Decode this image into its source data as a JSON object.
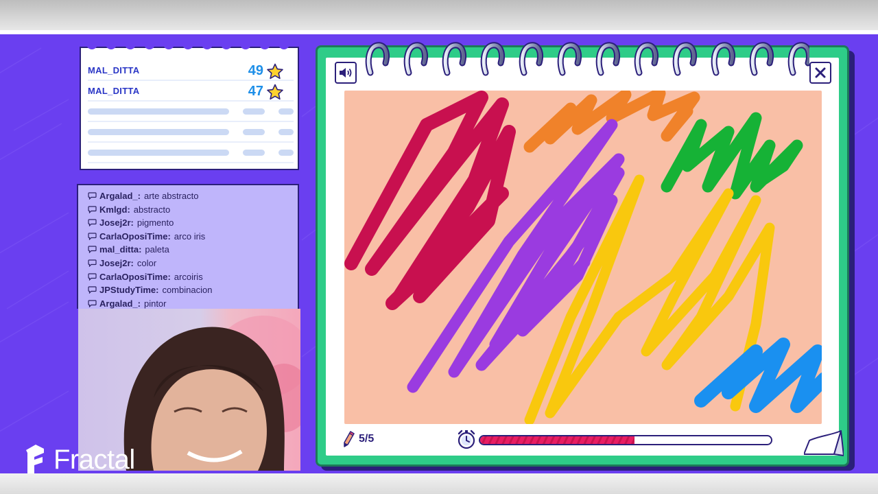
{
  "leaderboard": {
    "entries": [
      {
        "name": "MAL_DITTA",
        "points": "49"
      },
      {
        "name": "MAL_DITTA",
        "points": "47"
      }
    ]
  },
  "chat": {
    "messages": [
      {
        "user": "Argalad_:",
        "text": "arte abstracto"
      },
      {
        "user": "Kmlgd:",
        "text": "abstracto"
      },
      {
        "user": "Josej2r:",
        "text": "pigmento"
      },
      {
        "user": "CarlaOposiTime:",
        "text": "arco iris"
      },
      {
        "user": "mal_ditta:",
        "text": "paleta"
      },
      {
        "user": "Josej2r:",
        "text": "color"
      },
      {
        "user": "CarlaOposiTime:",
        "text": "arcoiris"
      },
      {
        "user": "JPStudyTime:",
        "text": "combinacion"
      },
      {
        "user": "Argalad_:",
        "text": "pintor"
      }
    ]
  },
  "brand": {
    "logo_text": "Fractal"
  },
  "game": {
    "round_label": "5/5",
    "timer_progress": 0.53,
    "canvas_color": "#f9bfa6",
    "stroke_colors": [
      "#c8104f",
      "#f0822a",
      "#16b236",
      "#9a3be0",
      "#f9c80e",
      "#1a90f0"
    ]
  },
  "icons": {
    "sound": "speaker-icon",
    "close": "close-icon",
    "round": "pencil-icon",
    "timer": "alarm-clock-icon",
    "score": "star-icon",
    "chat": "speech-bubble-icon"
  },
  "colors": {
    "background": "#6a3ff0",
    "notebook": "#2ecc88",
    "ink": "#2b1f7a"
  }
}
